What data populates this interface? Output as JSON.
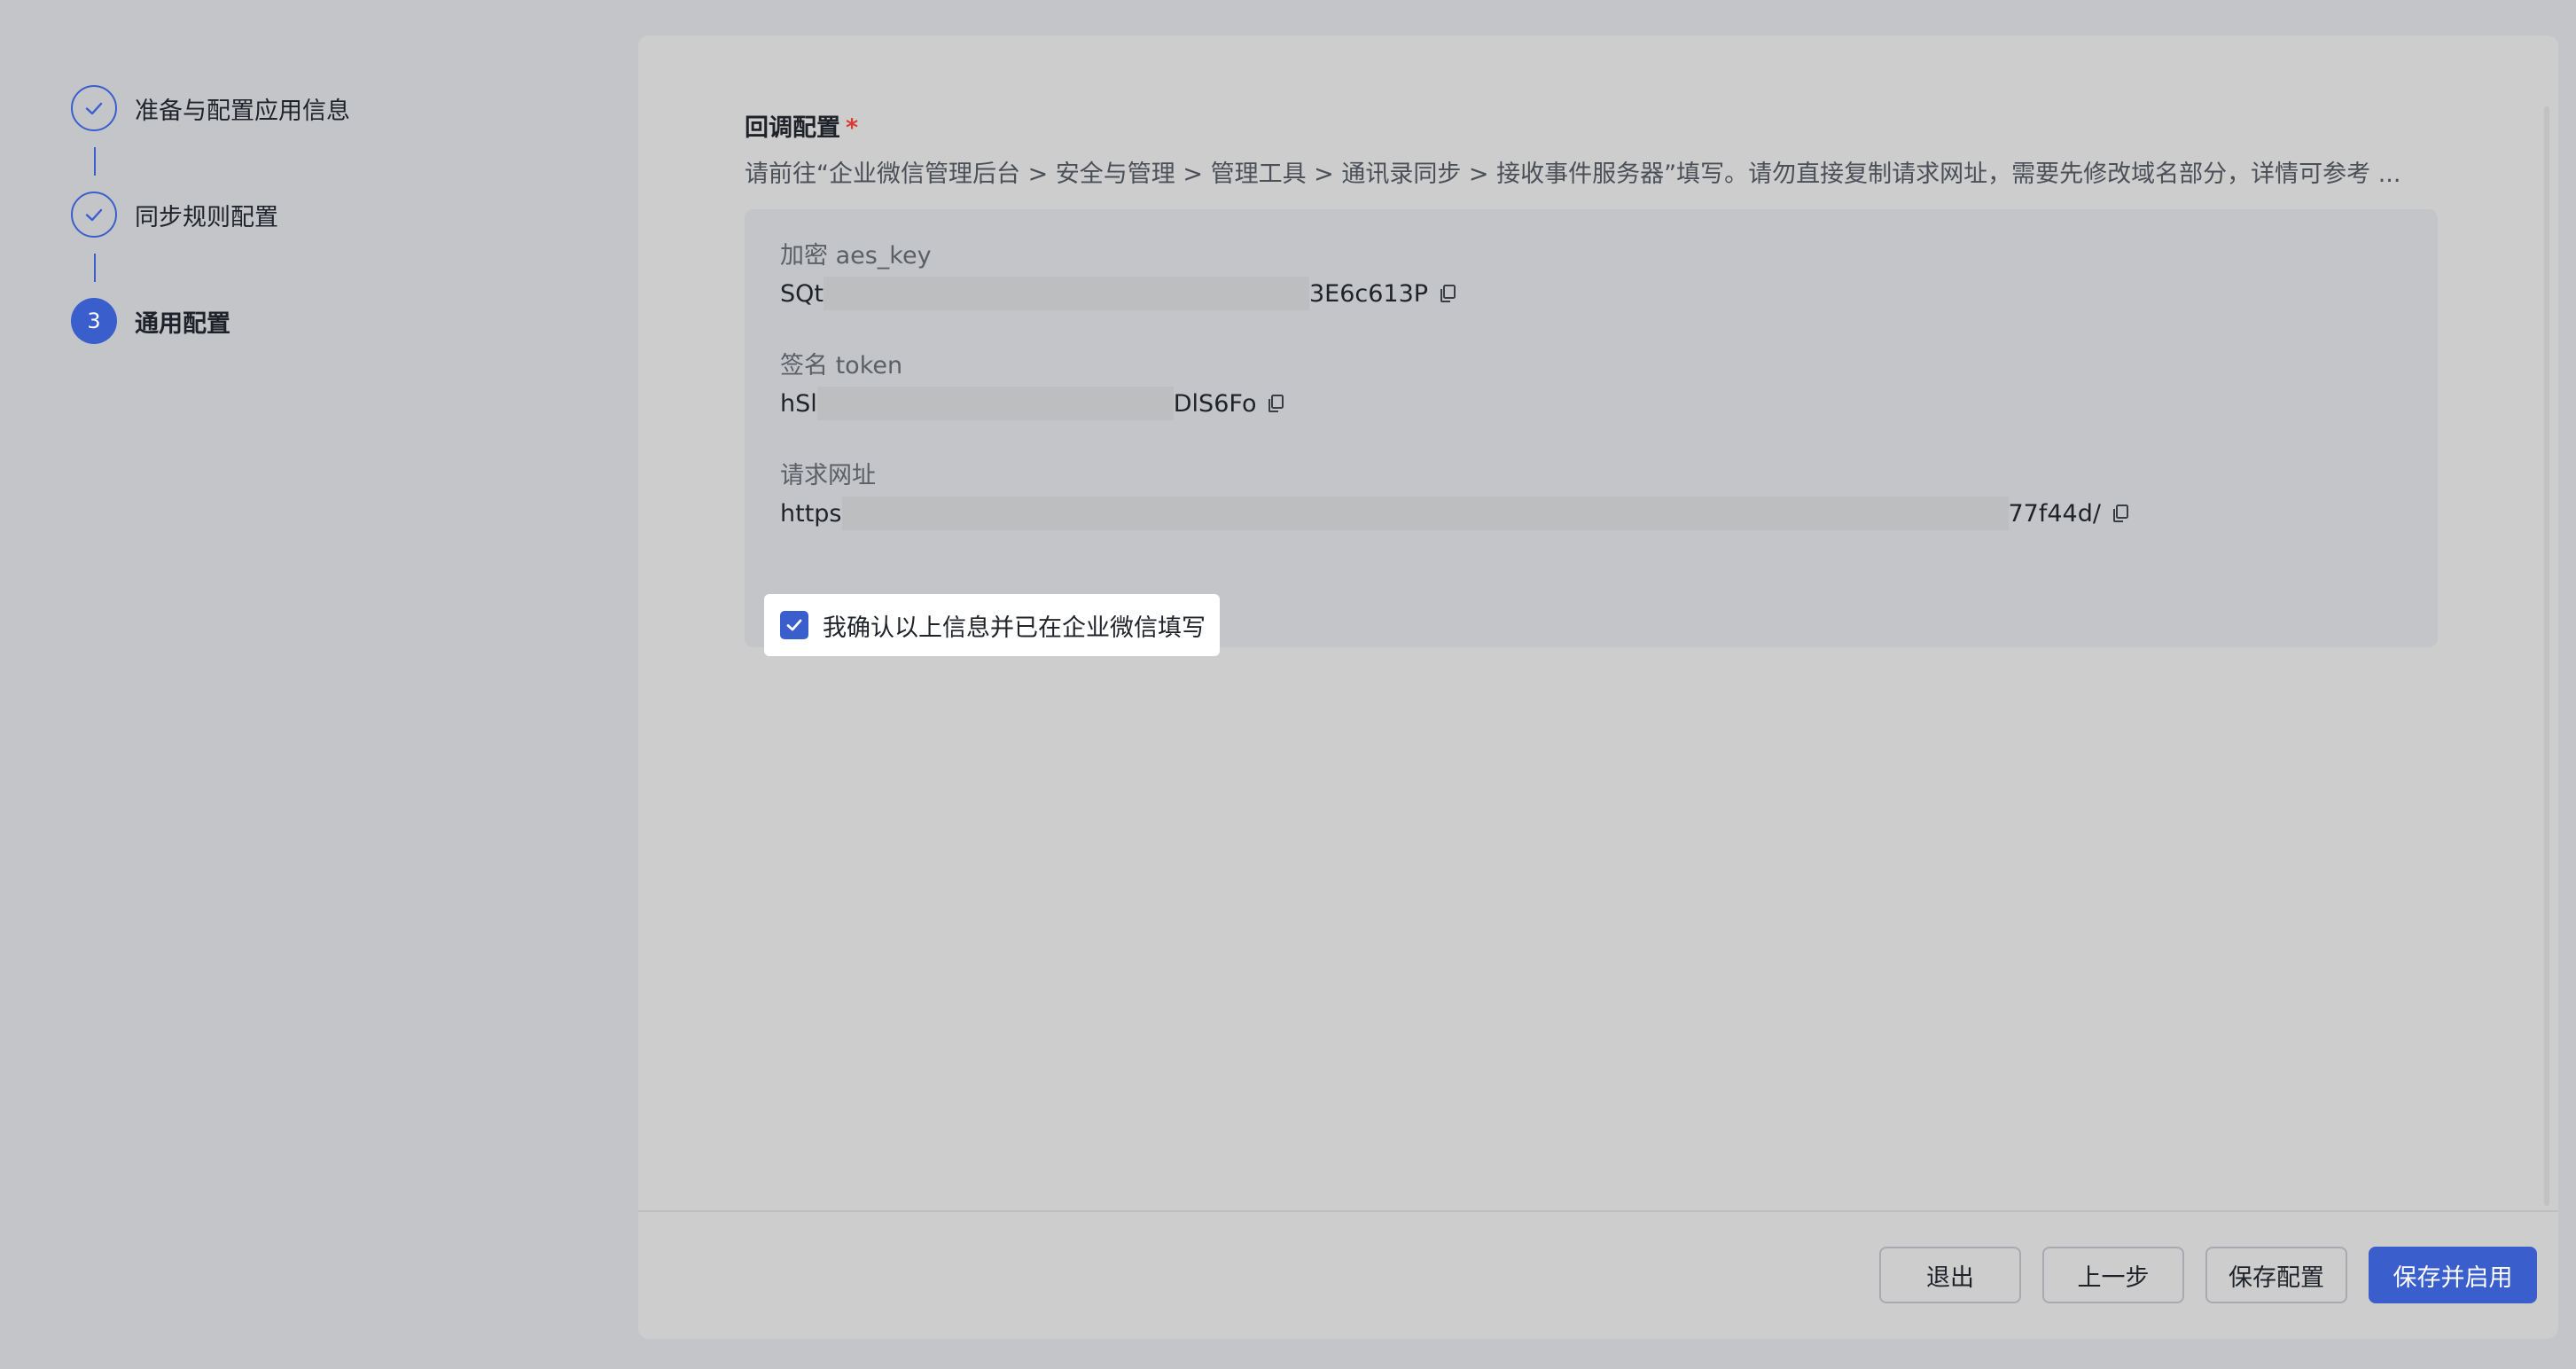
{
  "steps": [
    {
      "label": "准备与配置应用信息",
      "status": "done",
      "icon": "check-icon"
    },
    {
      "label": "同步规则配置",
      "status": "done",
      "icon": "check-icon"
    },
    {
      "label": "通用配置",
      "status": "active",
      "number": "3"
    }
  ],
  "callback": {
    "title": "回调配置",
    "required_mark": "*",
    "description": "请前往“企业微信管理后台 > 安全与管理 > 管理工具 > 通讯录同步 > 接收事件服务器”填写。请勿直接复制请求网址，需要先修改域名部分，详情可参考 ...",
    "fields": [
      {
        "label": "加密 aes_key",
        "prefix": "SQt",
        "suffix": "3E6c613P",
        "copy_icon": "copy-icon"
      },
      {
        "label": "签名 token",
        "prefix": "hSl",
        "suffix": "DlS6Fo",
        "copy_icon": "copy-icon"
      },
      {
        "label": "请求网址",
        "prefix": "https",
        "suffix": "77f44d/",
        "copy_icon": "copy-icon"
      }
    ],
    "confirm": {
      "checked": true,
      "label": "我确认以上信息并已在企业微信填写"
    }
  },
  "footer": {
    "exit": "退出",
    "prev": "上一步",
    "save": "保存配置",
    "save_enable": "保存并启用"
  },
  "colors": {
    "primary": "#3a5fcd",
    "required": "#d83931",
    "overlay_bg": "#c4c5c9"
  }
}
